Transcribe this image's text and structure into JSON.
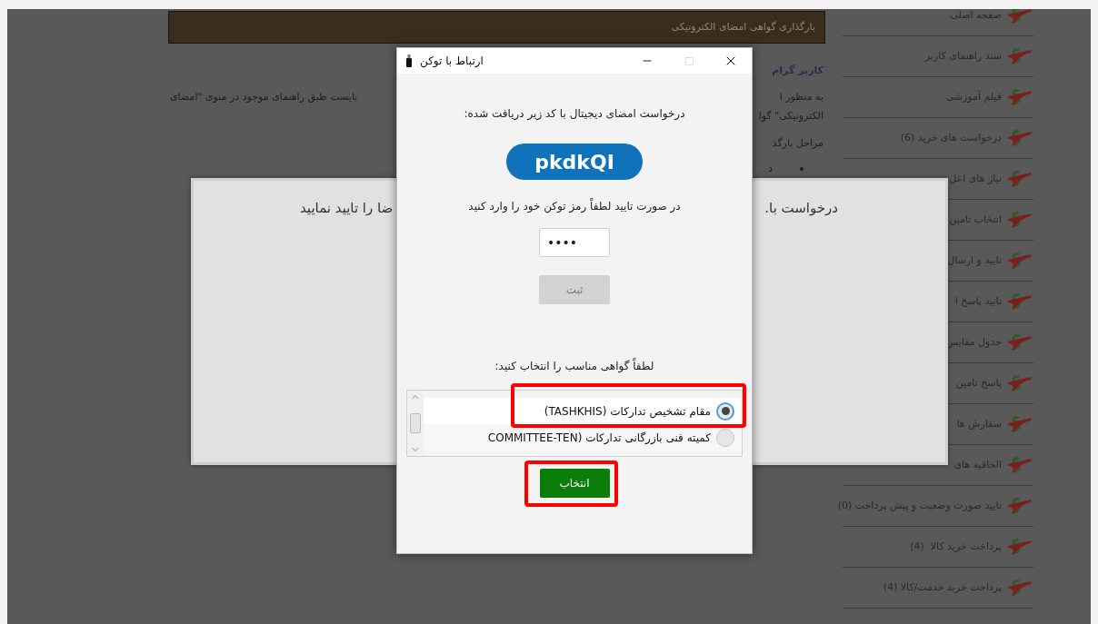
{
  "page": {
    "header": "بارگذاری گواهی امضای الکترونیکی",
    "greeting": "کاربر گرام",
    "paragraph_lines": [
      {
        "right": "به منظور ا",
        "left": "بایست طبق راهنمای موجود در منوی \"امضای"
      },
      {
        "right": "الکترونیکی\" گوا"
      }
    ],
    "steps_heading": "مراحل بارگذ",
    "bullet_text": "د"
  },
  "sidebar": {
    "items": [
      {
        "label": "صفحه اصلی"
      },
      {
        "label": "سند راهنمای کاربر"
      },
      {
        "label": "فیلم آموزشی"
      },
      {
        "label": "درخواست های خرید (6)"
      },
      {
        "label": "نیاز های اعل"
      },
      {
        "label": "انتخاب تامین"
      },
      {
        "label": "تایید و ارسال"
      },
      {
        "label": "تایید پاسخ ا"
      },
      {
        "label": "جدول مقایس"
      },
      {
        "label": "پاسخ تامین"
      },
      {
        "label": "سفارش ها"
      },
      {
        "label": "الحاقیه های"
      },
      {
        "label": "تایید صورت وضعیت و پیش پرداخت (0)"
      },
      {
        "label": "پرداخت خرید کالا  (4)"
      },
      {
        "label": "پرداخت خرید خدمت/کالا (4)"
      }
    ]
  },
  "notice_popup": {
    "line_right": ".درخواست با",
    "line_left": "ضا را تایید نمایید"
  },
  "dialog": {
    "title": "ارتباط با توکن",
    "request_label": "درخواست امضای دیجیتال با کد زیر دریافت شده:",
    "code": "pkdkQI",
    "pin_label": "در صورت تایید لطفاً رمز توکن خود را وارد کنید",
    "pin_value": "••••",
    "submit_button": {
      "label": "ثبت",
      "disabled": true
    },
    "certificate_label": "لطفاً گواهی مناسب را انتخاب کنید:",
    "certificates": [
      {
        "label": "مقام تشخیص تدارکات (TASHKHIS)",
        "selected": true,
        "annotated": true
      },
      {
        "label": "کمیته فنی بازرگانی تدارکات (COMMITTEE-TEN",
        "selected": false,
        "annotated": false
      }
    ],
    "select_button": {
      "label": "انتخاب",
      "annotated": true
    }
  }
}
